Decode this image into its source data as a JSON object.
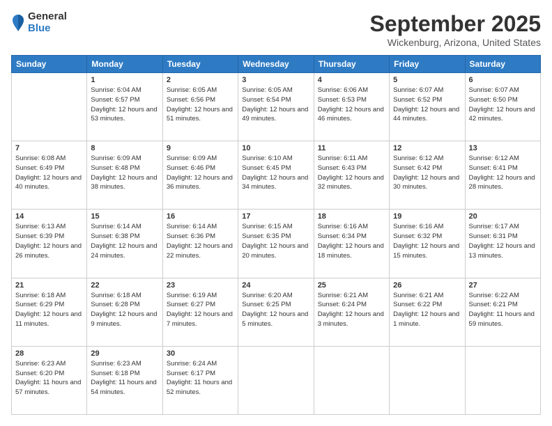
{
  "logo": {
    "general": "General",
    "blue": "Blue"
  },
  "title": "September 2025",
  "location": "Wickenburg, Arizona, United States",
  "weekdays": [
    "Sunday",
    "Monday",
    "Tuesday",
    "Wednesday",
    "Thursday",
    "Friday",
    "Saturday"
  ],
  "weeks": [
    [
      {
        "day": null
      },
      {
        "day": "1",
        "sunrise": "6:04 AM",
        "sunset": "6:57 PM",
        "daylight": "12 hours and 53 minutes."
      },
      {
        "day": "2",
        "sunrise": "6:05 AM",
        "sunset": "6:56 PM",
        "daylight": "12 hours and 51 minutes."
      },
      {
        "day": "3",
        "sunrise": "6:05 AM",
        "sunset": "6:54 PM",
        "daylight": "12 hours and 49 minutes."
      },
      {
        "day": "4",
        "sunrise": "6:06 AM",
        "sunset": "6:53 PM",
        "daylight": "12 hours and 46 minutes."
      },
      {
        "day": "5",
        "sunrise": "6:07 AM",
        "sunset": "6:52 PM",
        "daylight": "12 hours and 44 minutes."
      },
      {
        "day": "6",
        "sunrise": "6:07 AM",
        "sunset": "6:50 PM",
        "daylight": "12 hours and 42 minutes."
      }
    ],
    [
      {
        "day": "7",
        "sunrise": "6:08 AM",
        "sunset": "6:49 PM",
        "daylight": "12 hours and 40 minutes."
      },
      {
        "day": "8",
        "sunrise": "6:09 AM",
        "sunset": "6:48 PM",
        "daylight": "12 hours and 38 minutes."
      },
      {
        "day": "9",
        "sunrise": "6:09 AM",
        "sunset": "6:46 PM",
        "daylight": "12 hours and 36 minutes."
      },
      {
        "day": "10",
        "sunrise": "6:10 AM",
        "sunset": "6:45 PM",
        "daylight": "12 hours and 34 minutes."
      },
      {
        "day": "11",
        "sunrise": "6:11 AM",
        "sunset": "6:43 PM",
        "daylight": "12 hours and 32 minutes."
      },
      {
        "day": "12",
        "sunrise": "6:12 AM",
        "sunset": "6:42 PM",
        "daylight": "12 hours and 30 minutes."
      },
      {
        "day": "13",
        "sunrise": "6:12 AM",
        "sunset": "6:41 PM",
        "daylight": "12 hours and 28 minutes."
      }
    ],
    [
      {
        "day": "14",
        "sunrise": "6:13 AM",
        "sunset": "6:39 PM",
        "daylight": "12 hours and 26 minutes."
      },
      {
        "day": "15",
        "sunrise": "6:14 AM",
        "sunset": "6:38 PM",
        "daylight": "12 hours and 24 minutes."
      },
      {
        "day": "16",
        "sunrise": "6:14 AM",
        "sunset": "6:36 PM",
        "daylight": "12 hours and 22 minutes."
      },
      {
        "day": "17",
        "sunrise": "6:15 AM",
        "sunset": "6:35 PM",
        "daylight": "12 hours and 20 minutes."
      },
      {
        "day": "18",
        "sunrise": "6:16 AM",
        "sunset": "6:34 PM",
        "daylight": "12 hours and 18 minutes."
      },
      {
        "day": "19",
        "sunrise": "6:16 AM",
        "sunset": "6:32 PM",
        "daylight": "12 hours and 15 minutes."
      },
      {
        "day": "20",
        "sunrise": "6:17 AM",
        "sunset": "6:31 PM",
        "daylight": "12 hours and 13 minutes."
      }
    ],
    [
      {
        "day": "21",
        "sunrise": "6:18 AM",
        "sunset": "6:29 PM",
        "daylight": "12 hours and 11 minutes."
      },
      {
        "day": "22",
        "sunrise": "6:18 AM",
        "sunset": "6:28 PM",
        "daylight": "12 hours and 9 minutes."
      },
      {
        "day": "23",
        "sunrise": "6:19 AM",
        "sunset": "6:27 PM",
        "daylight": "12 hours and 7 minutes."
      },
      {
        "day": "24",
        "sunrise": "6:20 AM",
        "sunset": "6:25 PM",
        "daylight": "12 hours and 5 minutes."
      },
      {
        "day": "25",
        "sunrise": "6:21 AM",
        "sunset": "6:24 PM",
        "daylight": "12 hours and 3 minutes."
      },
      {
        "day": "26",
        "sunrise": "6:21 AM",
        "sunset": "6:22 PM",
        "daylight": "12 hours and 1 minute."
      },
      {
        "day": "27",
        "sunrise": "6:22 AM",
        "sunset": "6:21 PM",
        "daylight": "11 hours and 59 minutes."
      }
    ],
    [
      {
        "day": "28",
        "sunrise": "6:23 AM",
        "sunset": "6:20 PM",
        "daylight": "11 hours and 57 minutes."
      },
      {
        "day": "29",
        "sunrise": "6:23 AM",
        "sunset": "6:18 PM",
        "daylight": "11 hours and 54 minutes."
      },
      {
        "day": "30",
        "sunrise": "6:24 AM",
        "sunset": "6:17 PM",
        "daylight": "11 hours and 52 minutes."
      },
      {
        "day": null
      },
      {
        "day": null
      },
      {
        "day": null
      },
      {
        "day": null
      }
    ]
  ]
}
